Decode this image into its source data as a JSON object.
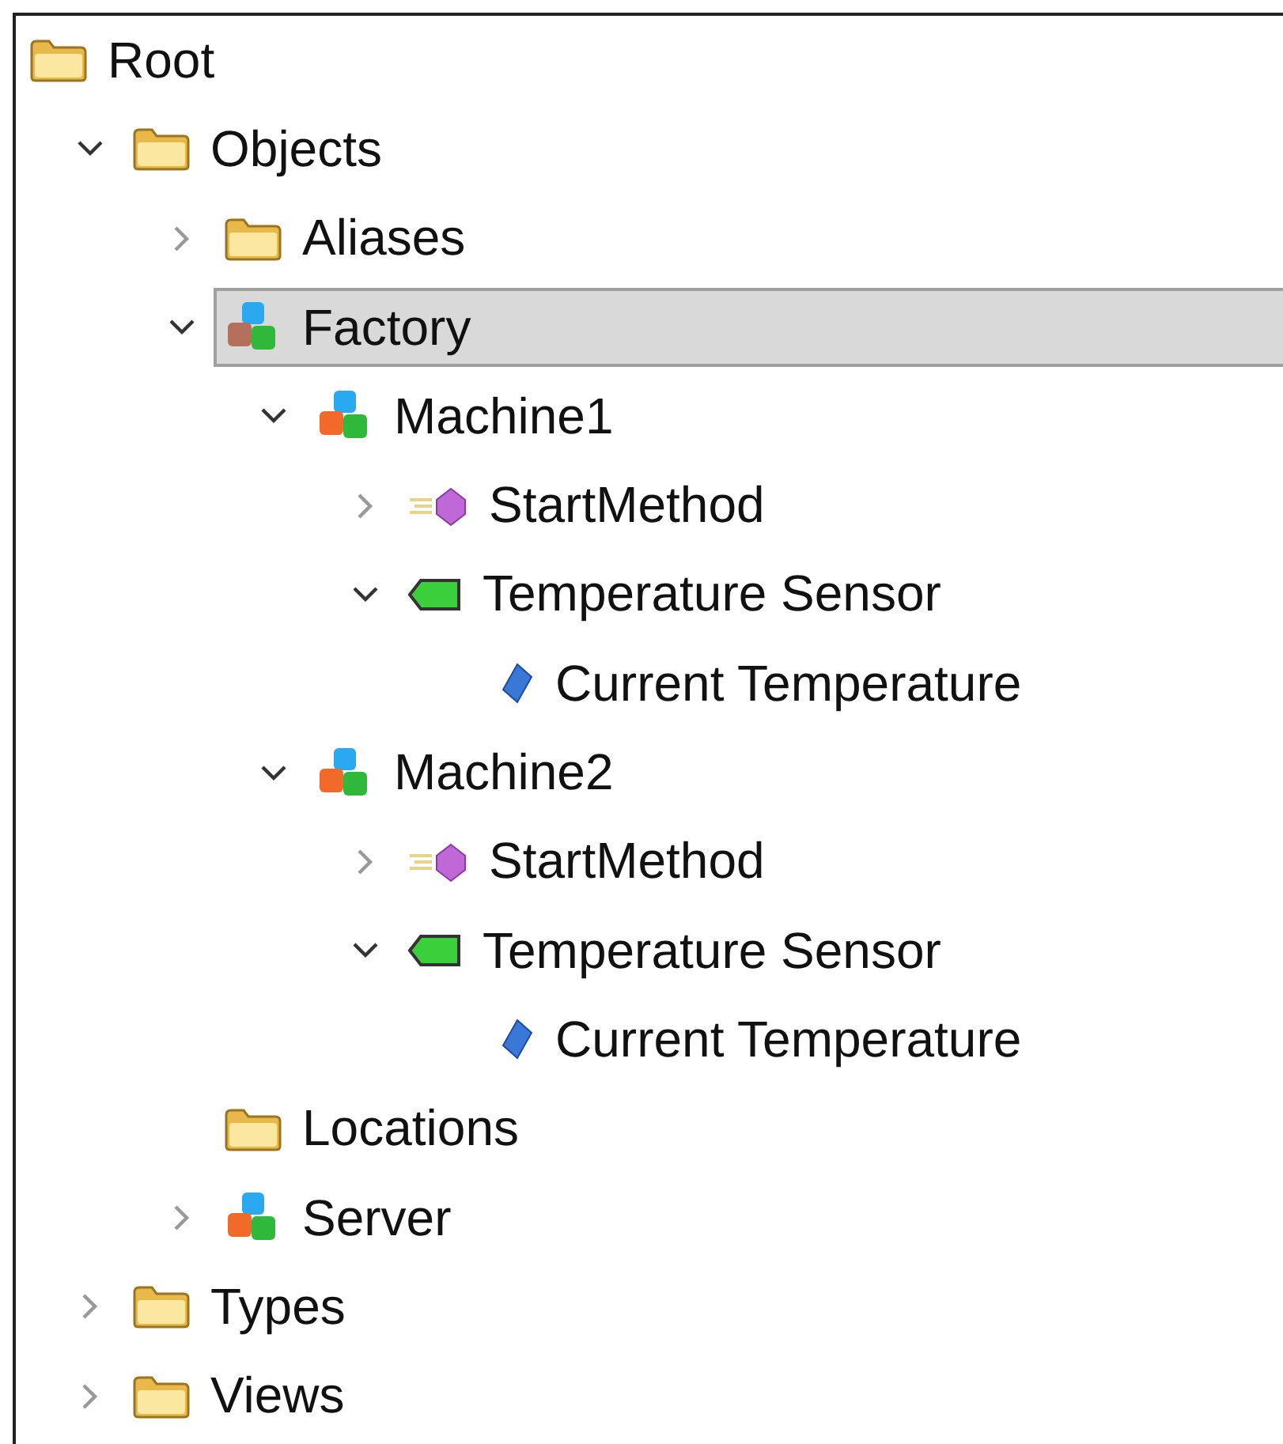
{
  "tree": [
    {
      "label": "Root",
      "kind": "folder",
      "selected": false,
      "children": [
        {
          "label": "Objects",
          "kind": "folder",
          "expanded": true,
          "selected": false,
          "children": [
            {
              "label": "Aliases",
              "kind": "folder",
              "expanded": false,
              "selected": false
            },
            {
              "label": "Factory",
              "kind": "object",
              "expanded": true,
              "selected": true,
              "children": [
                {
                  "label": "Machine1",
                  "kind": "object",
                  "expanded": true,
                  "selected": false,
                  "children": [
                    {
                      "label": "StartMethod",
                      "kind": "method",
                      "expanded": false,
                      "selected": false
                    },
                    {
                      "label": "Temperature Sensor",
                      "kind": "tag",
                      "expanded": true,
                      "selected": false,
                      "children": [
                        {
                          "label": "Current Temperature",
                          "kind": "variable",
                          "selected": false
                        }
                      ]
                    }
                  ]
                },
                {
                  "label": "Machine2",
                  "kind": "object",
                  "expanded": true,
                  "selected": false,
                  "children": [
                    {
                      "label": "StartMethod",
                      "kind": "method",
                      "expanded": false,
                      "selected": false
                    },
                    {
                      "label": "Temperature Sensor",
                      "kind": "tag",
                      "expanded": true,
                      "selected": false,
                      "children": [
                        {
                          "label": "Current Temperature",
                          "kind": "variable",
                          "selected": false
                        }
                      ]
                    }
                  ]
                }
              ]
            },
            {
              "label": "Locations",
              "kind": "folder",
              "selected": false
            },
            {
              "label": "Server",
              "kind": "object",
              "expanded": false,
              "selected": false
            }
          ]
        },
        {
          "label": "Types",
          "kind": "folder",
          "expanded": false,
          "selected": false
        },
        {
          "label": "Views",
          "kind": "folder",
          "expanded": false,
          "selected": false
        }
      ]
    }
  ]
}
